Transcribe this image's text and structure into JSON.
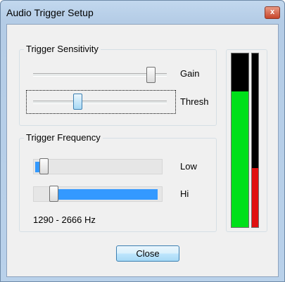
{
  "window": {
    "title": "Audio Trigger Setup",
    "close_glyph": "x"
  },
  "sensitivity": {
    "group_label": "Trigger Sensitivity",
    "gain_label": "Gain",
    "gain_level": 0.88,
    "thresh_label": "Thresh",
    "thresh_level": 0.33
  },
  "frequency": {
    "group_label": "Trigger Frequency",
    "low_label": "Low",
    "low_level": 0.08,
    "hi_label": "Hi",
    "hi_level": 0.16,
    "range_text": "1290 - 2666 Hz"
  },
  "meters": {
    "level_fraction": 0.78,
    "threshold_fraction": 0.34,
    "level_color": "#00e01a",
    "threshold_color": "#e01010"
  },
  "buttons": {
    "close_label": "Close"
  },
  "colors": {
    "accent": "#3399ff",
    "title_bar": "#b9d1ea"
  }
}
